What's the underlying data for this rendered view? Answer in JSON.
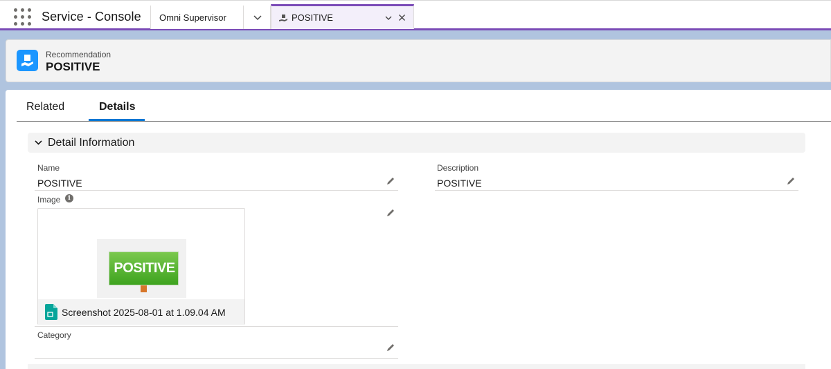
{
  "app": {
    "name": "Service - Console",
    "launcher_icon": "app-launcher-icon"
  },
  "tabs": [
    {
      "label": "Omni Supervisor",
      "active": false
    },
    {
      "label": "POSITIVE",
      "active": true,
      "icon": "recommendation-icon"
    }
  ],
  "colors": {
    "accent": "#7b4bb7",
    "tab_underline": "#0176d3",
    "record_icon": "#1b96ff",
    "file_icon": "#06a59a",
    "sign_green": "#3ea31f"
  },
  "header": {
    "object_type": "Recommendation",
    "title": "POSITIVE"
  },
  "record_tabs": [
    {
      "label": "Related",
      "active": false
    },
    {
      "label": "Details",
      "active": true
    }
  ],
  "section": {
    "title": "Detail Information",
    "expanded": true
  },
  "fields": {
    "name": {
      "label": "Name",
      "value": "POSITIVE"
    },
    "description": {
      "label": "Description",
      "value": "POSITIVE"
    },
    "image": {
      "label": "Image",
      "preview_text": "POSITIVE",
      "file_name": "Screenshot 2025-08-01 at 1.09.04 AM"
    },
    "category": {
      "label": "Category",
      "value": ""
    }
  }
}
